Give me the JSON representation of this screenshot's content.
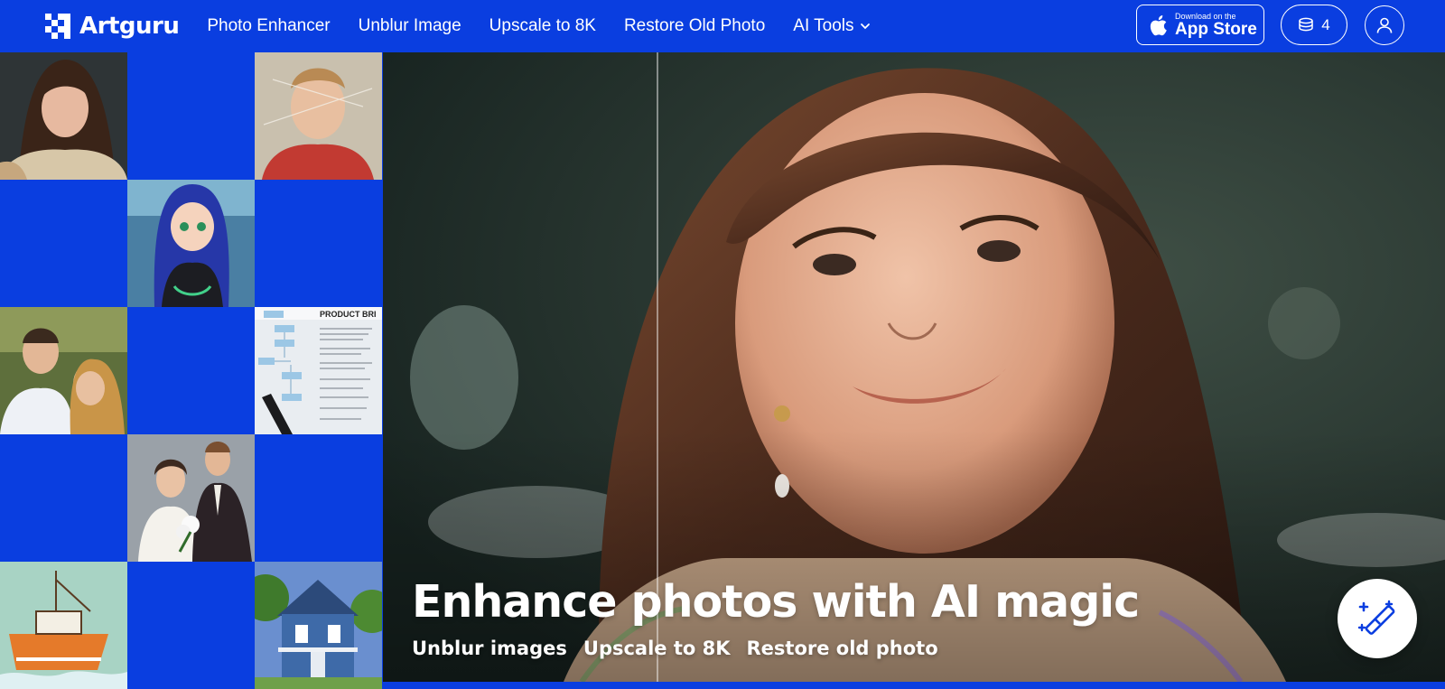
{
  "brand": {
    "name": "Artguru",
    "logo_icon": "artguru-logo-icon"
  },
  "nav": {
    "items": [
      {
        "label": "Photo Enhancer"
      },
      {
        "label": "Unblur Image"
      },
      {
        "label": "Upscale to 8K"
      },
      {
        "label": "Restore Old Photo"
      }
    ],
    "dropdown": {
      "label": "AI Tools",
      "icon": "chevron-down-icon"
    }
  },
  "actions": {
    "app_store": {
      "small": "Download on the",
      "big": "App Store",
      "icon": "apple-icon"
    },
    "credits": {
      "count": "4",
      "icon": "coins-icon"
    },
    "account": {
      "icon": "user-icon"
    }
  },
  "hero": {
    "title": "Enhance photos with AI magic",
    "tags": [
      "Unblur images",
      "Upscale to 8K",
      "Restore old photo"
    ],
    "fab_icon": "magic-wand-icon"
  },
  "colors": {
    "brand_blue": "#0a3ee0",
    "white": "#ffffff"
  }
}
